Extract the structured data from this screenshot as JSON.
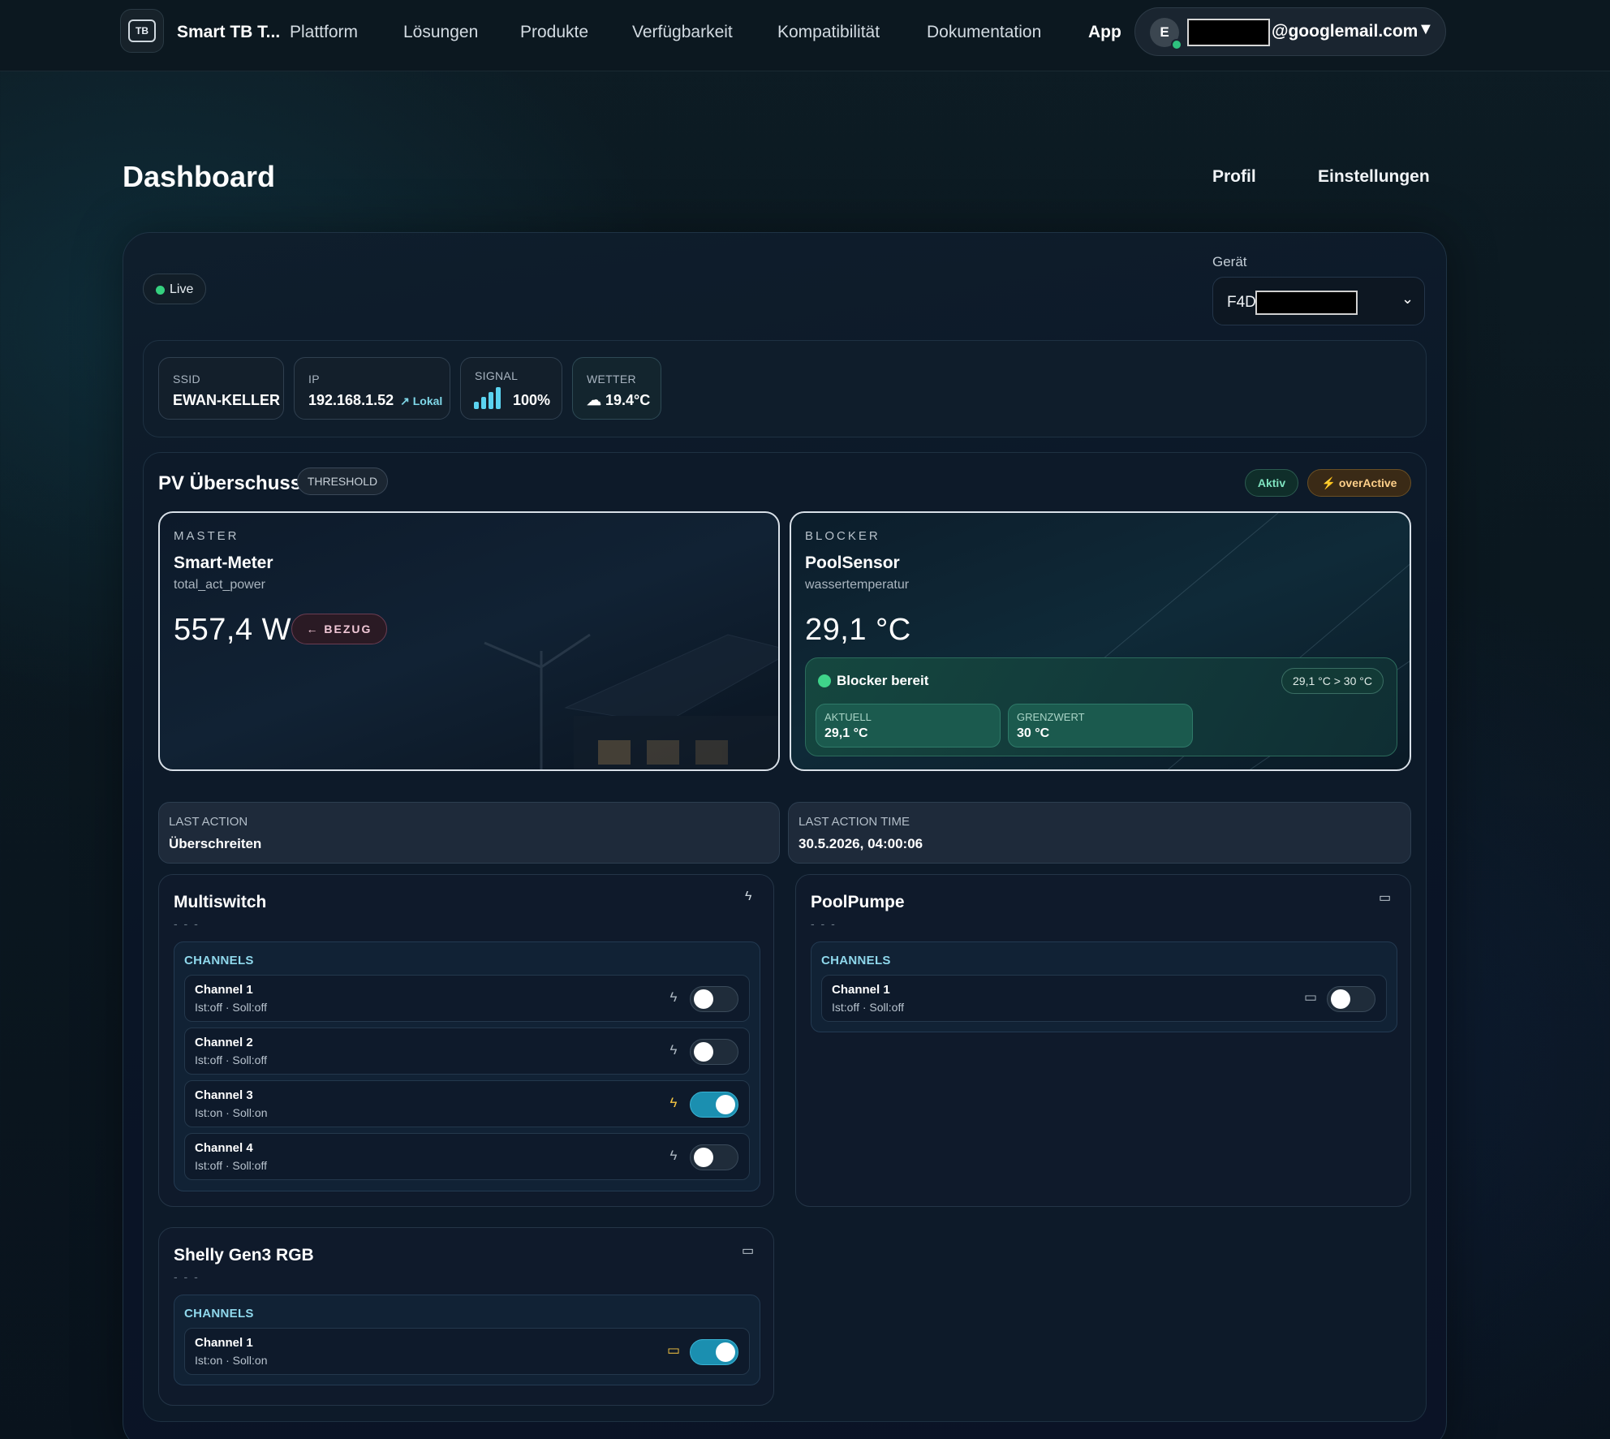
{
  "nav": {
    "brand": "Smart TB T...",
    "links": [
      "Plattform",
      "Lösungen",
      "Produkte",
      "Verfügbarkeit",
      "Kompatibilität",
      "Dokumentation"
    ],
    "app": "App",
    "user_initial": "E",
    "email_suffix": "@googlemail.com",
    "logo_text": "TB"
  },
  "page": {
    "title": "Dashboard",
    "profile": "Profil",
    "settings": "Einstellungen"
  },
  "status": {
    "live": "Live"
  },
  "device": {
    "label": "Gerät",
    "value_prefix": "F4D"
  },
  "stats": {
    "ssid": {
      "label": "SSID",
      "value": "EWAN-KELLER"
    },
    "ip": {
      "label": "IP",
      "value": "192.168.1.52",
      "sub": "↗ Lokal"
    },
    "signal": {
      "label": "SIGNAL",
      "value": "100%",
      "level": 1.0
    },
    "weather": {
      "label": "WETTER",
      "value": "☁ 19.4°C"
    }
  },
  "pv": {
    "title": "PV Überschuss",
    "mode": "THRESHOLD",
    "badges": {
      "aktiv": "Aktiv",
      "overactive": "⚡ overActive"
    },
    "master": {
      "kicker": "MASTER",
      "name": "Smart-Meter",
      "metric": "total_act_power",
      "value": "557,4 W",
      "direction": "← BEZUG"
    },
    "blocker": {
      "kicker": "BLOCKER",
      "name": "PoolSensor",
      "metric": "wassertemperatur",
      "value": "29,1 °C",
      "status": "Blocker bereit",
      "condition": "29,1 °C > 30 °C",
      "current_label": "AKTUELL",
      "current_value": "29,1 °C",
      "limit_label": "GRENZWERT",
      "limit_value": "30 °C"
    },
    "last_action": {
      "label": "LAST ACTION",
      "value": "Überschreiten"
    },
    "last_action_time": {
      "label": "LAST ACTION TIME",
      "value": "30.5.2026, 04:00:06"
    }
  },
  "devices": {
    "multiswitch": {
      "name": "Multiswitch",
      "dash": "- - -",
      "channels_label": "CHANNELS",
      "channels": [
        {
          "name": "Channel 1",
          "state": "Ist:off · Soll:off",
          "on": false
        },
        {
          "name": "Channel 2",
          "state": "Ist:off · Soll:off",
          "on": false
        },
        {
          "name": "Channel 3",
          "state": "Ist:on · Soll:on",
          "on": true
        },
        {
          "name": "Channel 4",
          "state": "Ist:off · Soll:off",
          "on": false
        }
      ]
    },
    "poolpumpe": {
      "name": "PoolPumpe",
      "dash": "- - -",
      "channels_label": "CHANNELS",
      "channels": [
        {
          "name": "Channel 1",
          "state": "Ist:off · Soll:off",
          "on": false
        }
      ]
    },
    "shelly": {
      "name": "Shelly Gen3 RGB",
      "dash": "- - -",
      "channels_label": "CHANNELS",
      "channels": [
        {
          "name": "Channel 1",
          "state": "Ist:on · Soll:on",
          "on": true
        }
      ]
    }
  },
  "colors": {
    "accent": "#1b8fb0",
    "active_icon": "#f5c542",
    "live": "#35d07f"
  }
}
